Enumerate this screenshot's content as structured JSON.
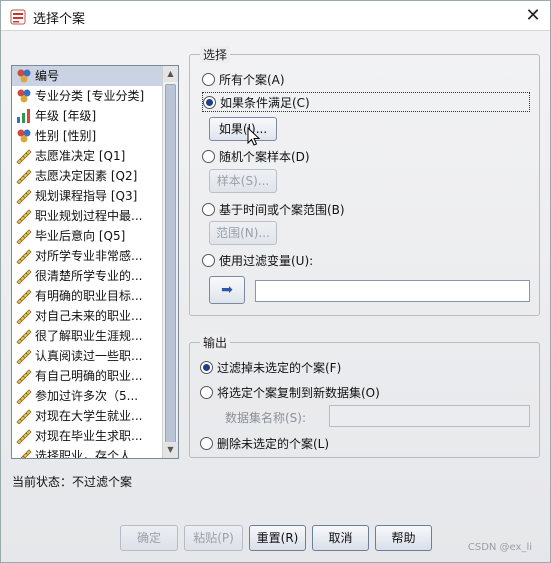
{
  "window": {
    "title": "选择个案",
    "close_glyph": "✕"
  },
  "variable_list": {
    "items": [
      {
        "label": "编号",
        "icon": "nominal-icon",
        "selected": true
      },
      {
        "label": "专业分类 [专业分类]",
        "icon": "nominal-icon"
      },
      {
        "label": "年级 [年级]",
        "icon": "ordinal-icon"
      },
      {
        "label": "性别 [性别]",
        "icon": "nominal-icon"
      },
      {
        "label": "志愿准决定 [Q1]",
        "icon": "scale-icon"
      },
      {
        "label": "志愿决定因素 [Q2]",
        "icon": "scale-icon"
      },
      {
        "label": "规划课程指导 [Q3]",
        "icon": "scale-icon"
      },
      {
        "label": "职业规划过程中最...",
        "icon": "scale-icon"
      },
      {
        "label": "毕业后意向 [Q5]",
        "icon": "scale-icon"
      },
      {
        "label": "对所学专业非常感...",
        "icon": "scale-icon"
      },
      {
        "label": "很清楚所学专业的...",
        "icon": "scale-icon"
      },
      {
        "label": "有明确的职业目标...",
        "icon": "scale-icon"
      },
      {
        "label": "对自己未来的职业...",
        "icon": "scale-icon"
      },
      {
        "label": "很了解职业生涯规...",
        "icon": "scale-icon"
      },
      {
        "label": "认真阅读过一些职...",
        "icon": "scale-icon"
      },
      {
        "label": "有自己明确的职业...",
        "icon": "scale-icon"
      },
      {
        "label": "参加过许多次（5...",
        "icon": "scale-icon"
      },
      {
        "label": "对现在大学生就业...",
        "icon": "scale-icon"
      },
      {
        "label": "对现在毕业生求职...",
        "icon": "scale-icon"
      },
      {
        "label": "选择职业，存个人...",
        "icon": "scale-icon"
      }
    ]
  },
  "select_group": {
    "title": "选择",
    "all_cases": "所有个案(A)",
    "if_condition": "如果条件满足(C)",
    "if_button": "如果(I)...",
    "random_sample": "随机个案样本(D)",
    "sample_button": "样本(S)...",
    "time_range": "基于时间或个案范围(B)",
    "range_button": "范围(N)...",
    "filter_var": "使用过滤变量(U):",
    "arrow_glyph": "➡",
    "selected_option": "if_condition"
  },
  "output_group": {
    "title": "输出",
    "filter_out": "过滤掉未选定的个案(F)",
    "copy_to_dataset": "将选定个案复制到新数据集(O)",
    "dataset_name_label": "数据集名称(S):",
    "delete_unselected": "删除未选定的个案(L)",
    "selected_option": "filter_out"
  },
  "status": {
    "text": "当前状态：不过滤个案"
  },
  "buttons": {
    "ok": "确定",
    "paste": "粘贴(P)",
    "reset": "重置(R)",
    "cancel": "取消",
    "help": "帮助"
  },
  "watermark": "CSDN @ex_li",
  "colors": {
    "nominal": "#c0392b",
    "ordinal": "#d4762a",
    "scale": "#c8a13a",
    "accent": "#1f3f8a"
  }
}
